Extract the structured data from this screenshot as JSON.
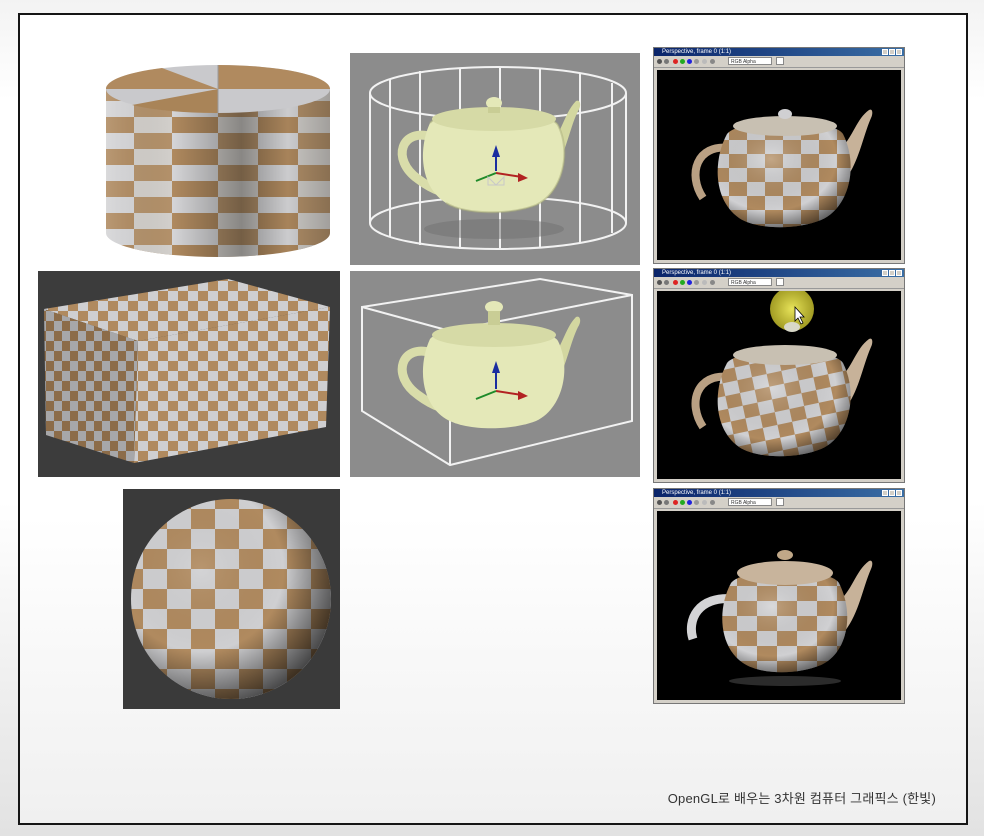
{
  "caption": "OpenGL로 배우는 3차원 컴퓨터 그래픽스 (한빛)",
  "colors": {
    "checker_tan": "#b08a5f",
    "checker_light": "#d6d6d8",
    "teapot_yellow": "#dfe3b0",
    "viewport_gray": "#8c8c8c",
    "dark_bg": "#3c3c3c"
  },
  "render_windows": [
    {
      "title": "Perspective, frame 0 (1:1)",
      "channel": "RGB Alpha"
    },
    {
      "title": "Perspective, frame 0 (1:1)",
      "channel": "RGB Alpha"
    },
    {
      "title": "Perspective, frame 0 (1:1)",
      "channel": "RGB Alpha"
    }
  ]
}
